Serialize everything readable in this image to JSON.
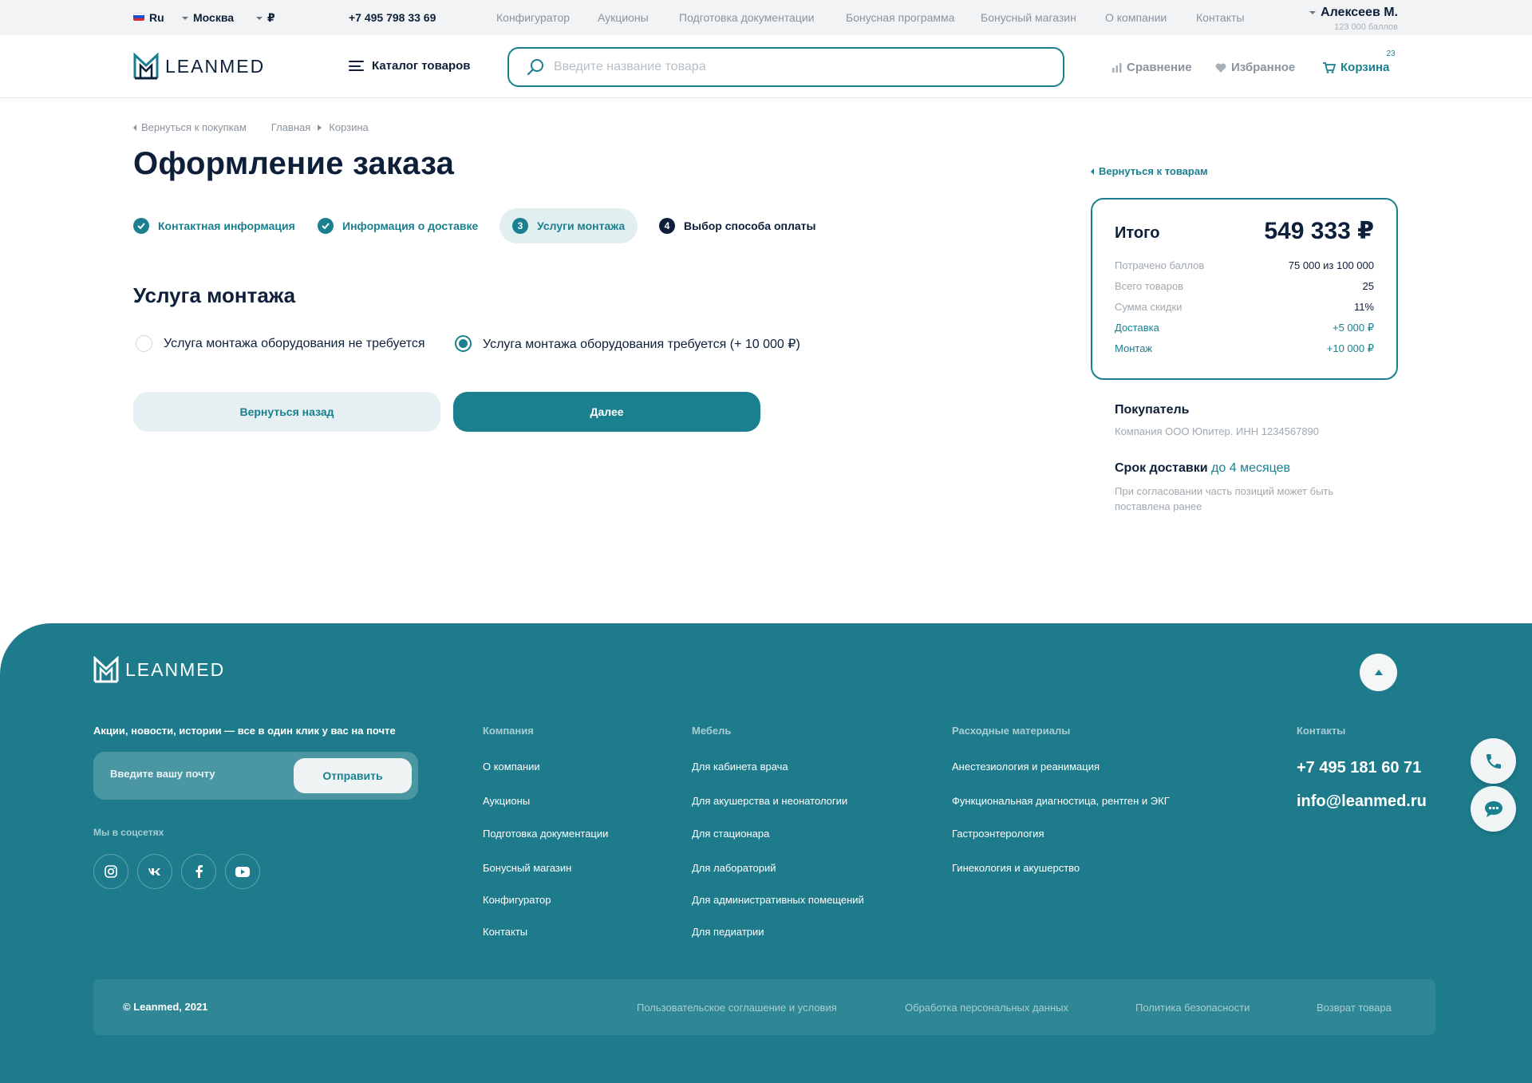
{
  "topbar": {
    "language": "Ru",
    "city": "Москва",
    "currency": "₽",
    "phone": "+7 495 798 33 69",
    "nav": [
      "Конфигуратор",
      "Аукционы",
      "Подготовка документации",
      "Бонусная программа",
      "Бонусный магазин",
      "О компании",
      "Контакты"
    ],
    "user_name": "Алексеев М.",
    "user_points": "123 000 баллов"
  },
  "header": {
    "logo": "LEANMED",
    "catalog": "Каталог товаров",
    "search_placeholder": "Введите название товара",
    "compare": "Сравнение",
    "favorites": "Избранное",
    "cart": "Корзина",
    "cart_count": "23"
  },
  "breadcrumbs": {
    "back": "Вернуться к покупкам",
    "items": [
      "Главная",
      "Корзина"
    ]
  },
  "page_title": "Оформление заказа",
  "steps": [
    {
      "num": "",
      "label": "Контактная информация"
    },
    {
      "num": "",
      "label": "Информация о доставке"
    },
    {
      "num": "3",
      "label": "Услуги монтажа"
    },
    {
      "num": "4",
      "label": "Выбор способа оплаты"
    }
  ],
  "section_title": "Услуга монтажа",
  "options": [
    {
      "label": "Услуга монтажа оборудования не требуется",
      "checked": false
    },
    {
      "label": "Услуга монтажа оборудования требуется (+ 10 000 ₽)",
      "checked": true
    }
  ],
  "buttons": {
    "back": "Вернуться назад",
    "next": "Далее"
  },
  "summary": {
    "back_link": "Вернуться к товарам",
    "title": "Итого",
    "total": "549 333 ₽",
    "rows": [
      {
        "key": "Потрачено баллов",
        "value": "75 000 из 100 000"
      },
      {
        "key": "Всего товаров",
        "value": "25"
      },
      {
        "key": "Сумма скидки",
        "value": "11%"
      },
      {
        "key": "Доставка",
        "value": "+5 000 ₽"
      },
      {
        "key": "Монтаж",
        "value": "+10 000 ₽"
      }
    ],
    "buyer_title": "Покупатель",
    "buyer_value": "Компания ООО Юпитер. ИНН 1234567890",
    "delivery_title": "Срок доставки",
    "delivery_term": "до 4 месяцев",
    "delivery_note": "При согласовании часть позиций может быть поставлена ранее"
  },
  "footer": {
    "logo": "LEANMED",
    "subscribe_text": "Акции, новости, истории — все в один клик у вас на почте",
    "email_placeholder": "Введите вашу почту",
    "send": "Отправить",
    "social_title": "Мы в соцсетях",
    "columns": [
      {
        "title": "Компания",
        "items": [
          "О компании",
          "Аукционы",
          "Подготовка документации",
          "Бонусный магазин",
          "Конфигуратор",
          "Контакты"
        ]
      },
      {
        "title": "Мебель",
        "items": [
          "Для кабинета врача",
          "Для акушерства и неонатологии",
          "Для стационара",
          "Для лабораторий",
          "Для административных помещений",
          "Для педиатрии"
        ]
      },
      {
        "title": "Расходные материалы",
        "items": [
          "Анестезиология и реанимация",
          "Функциональная диагностица, рентген и ЭКГ",
          "Гастроэнтерология",
          "Гинекология и акушерство"
        ]
      }
    ],
    "contacts_title": "Контакты",
    "phone": "+7 495 181 60 71",
    "email": "info@leanmed.ru",
    "copyright": "© Leanmed, 2021",
    "legal": [
      "Пользовательское соглашение и условия",
      "Обработка персональных данных",
      "Политика безопасности",
      "Возврат товара"
    ]
  },
  "colors": {
    "accent": "#1a7f8f",
    "dark": "#0e1f3a",
    "footer": "#1d7b8c"
  }
}
